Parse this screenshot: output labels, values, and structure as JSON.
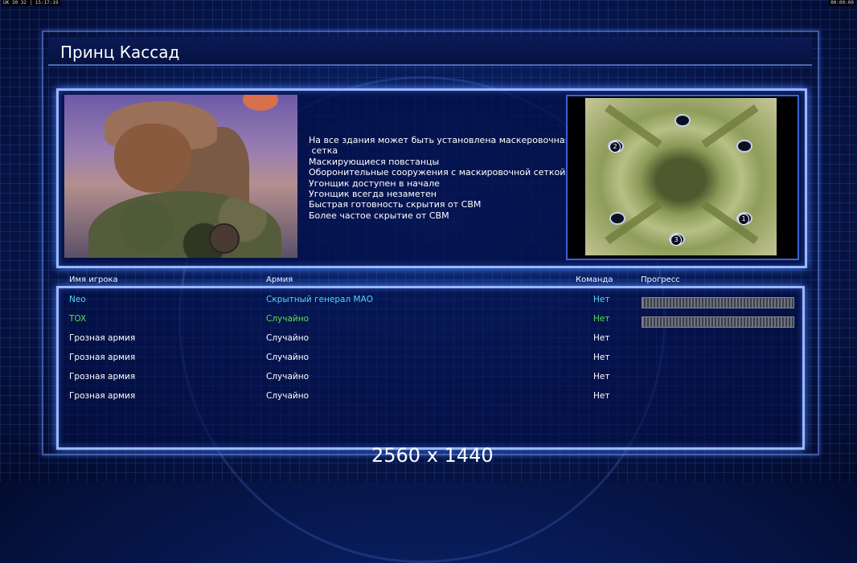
{
  "status_bar": {
    "left_text": "UK 30 32 | 15:17:19",
    "right_text": "00:00:00"
  },
  "title": "Принц Кассад",
  "description_lines": [
    "На все здания может быть установлена маскеровочная",
    " сетка",
    "Маскирующиеся повстанцы",
    "Оборонительные сооружения с маскировочной сеткой",
    "Угонщик доступен в начале",
    "Угонщик всегда незаметен",
    "Быстрая готовность скрытия от СВМ",
    "Более частое скрытие от СВМ"
  ],
  "minimap": {
    "start_labels": [
      "1",
      "2",
      "3"
    ]
  },
  "table": {
    "headers": {
      "name": "Имя игрока",
      "army": "Армия",
      "team": "Команда",
      "progress": "Прогресс"
    },
    "rows": [
      {
        "name": "Neo",
        "army": "Скрытный генерал МАО",
        "team": "Нет",
        "has_progress": true,
        "color": "#4fd6ff"
      },
      {
        "name": "TOX",
        "army": "Случайно",
        "team": "Нет",
        "has_progress": true,
        "color": "#58e24a"
      },
      {
        "name": "Грозная армия",
        "army": "Случайно",
        "team": "Нет",
        "has_progress": false,
        "color": "#ffffff"
      },
      {
        "name": "Грозная армия",
        "army": "Случайно",
        "team": "Нет",
        "has_progress": false,
        "color": "#ffffff"
      },
      {
        "name": "Грозная армия",
        "army": "Случайно",
        "team": "Нет",
        "has_progress": false,
        "color": "#ffffff"
      },
      {
        "name": "Грозная армия",
        "army": "Случайно",
        "team": "Нет",
        "has_progress": false,
        "color": "#ffffff"
      }
    ]
  },
  "resolution_caption": "2560 x 1440"
}
